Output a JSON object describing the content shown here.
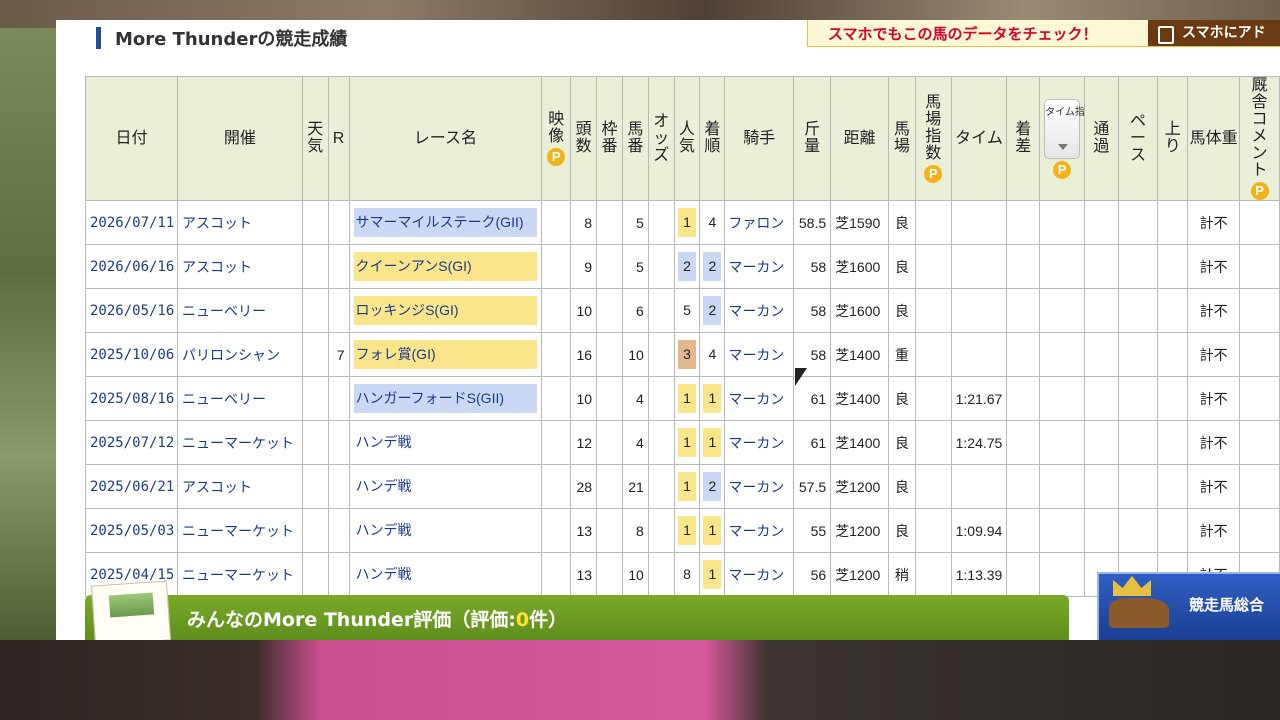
{
  "section_title": "More Thunderの競走成績",
  "promo": {
    "text": "スマホでもこの馬のデータをチェック！",
    "button": "スマホにアド"
  },
  "columns": {
    "date": "日付",
    "venue": "開催",
    "weather": "天気",
    "race_no": "R",
    "race_name": "レース名",
    "video": "映像",
    "runners": "頭数",
    "gate": "枠番",
    "horse_no": "馬番",
    "odds": "オッズ",
    "popularity": "人気",
    "finish": "着順",
    "jockey": "騎手",
    "weight": "斤量",
    "distance": "距離",
    "track": "馬場",
    "track_index": "馬場指数",
    "time": "タイム",
    "margin": "着差",
    "time_index": "タイム指数",
    "passing": "通過",
    "pace": "ペース",
    "last3f": "上り",
    "body_weight": "馬体重",
    "stable_comment": "厩舎コメント",
    "p_badge": "P"
  },
  "rows": [
    {
      "date": "2026/07/11",
      "venue": "アスコット",
      "race_no": "",
      "race": "サマーマイルステーク(GII)",
      "grade": "g2",
      "runners": "8",
      "gate": "",
      "horse_no": "5",
      "popularity": "1",
      "pop_class": "p1",
      "finish": "4",
      "fin_class": "",
      "jockey": "ファロン",
      "weight": "58.5",
      "distance": "芝1590",
      "track": "良",
      "time": "",
      "body_weight": "計不"
    },
    {
      "date": "2026/06/16",
      "venue": "アスコット",
      "race_no": "",
      "race": "クイーンアンS(GI)",
      "grade": "g1",
      "runners": "9",
      "gate": "",
      "horse_no": "5",
      "popularity": "2",
      "pop_class": "p2",
      "finish": "2",
      "fin_class": "p2",
      "jockey": "マーカン",
      "weight": "58",
      "distance": "芝1600",
      "track": "良",
      "time": "",
      "body_weight": "計不"
    },
    {
      "date": "2026/05/16",
      "venue": "ニューベリー",
      "race_no": "",
      "race": "ロッキンジS(GI)",
      "grade": "g1",
      "runners": "10",
      "gate": "",
      "horse_no": "6",
      "popularity": "5",
      "pop_class": "",
      "finish": "2",
      "fin_class": "p2",
      "jockey": "マーカン",
      "weight": "58",
      "distance": "芝1600",
      "track": "良",
      "time": "",
      "body_weight": "計不"
    },
    {
      "date": "2025/10/06",
      "venue": "パリロンシャン",
      "race_no": "7",
      "race": "フォレ賞(GI)",
      "grade": "g1",
      "runners": "16",
      "gate": "",
      "horse_no": "10",
      "popularity": "3",
      "pop_class": "p3",
      "finish": "4",
      "fin_class": "",
      "jockey": "マーカン",
      "weight": "58",
      "distance": "芝1400",
      "track": "重",
      "time": "",
      "body_weight": "計不"
    },
    {
      "date": "2025/08/16",
      "venue": "ニューベリー",
      "race_no": "",
      "race": "ハンガーフォードS(GII)",
      "grade": "g2",
      "runners": "10",
      "gate": "",
      "horse_no": "4",
      "popularity": "1",
      "pop_class": "p1",
      "finish": "1",
      "fin_class": "p1",
      "jockey": "マーカン",
      "weight": "61",
      "distance": "芝1400",
      "track": "良",
      "time": "1:21.67",
      "body_weight": "計不"
    },
    {
      "date": "2025/07/12",
      "venue": "ニューマーケット",
      "race_no": "",
      "race": "ハンデ戦",
      "grade": "",
      "runners": "12",
      "gate": "",
      "horse_no": "4",
      "popularity": "1",
      "pop_class": "p1",
      "finish": "1",
      "fin_class": "p1",
      "jockey": "マーカン",
      "weight": "61",
      "distance": "芝1400",
      "track": "良",
      "time": "1:24.75",
      "body_weight": "計不"
    },
    {
      "date": "2025/06/21",
      "venue": "アスコット",
      "race_no": "",
      "race": "ハンデ戦",
      "grade": "",
      "runners": "28",
      "gate": "",
      "horse_no": "21",
      "popularity": "1",
      "pop_class": "p1",
      "finish": "2",
      "fin_class": "p2",
      "jockey": "マーカン",
      "weight": "57.5",
      "distance": "芝1200",
      "track": "良",
      "time": "",
      "body_weight": "計不"
    },
    {
      "date": "2025/05/03",
      "venue": "ニューマーケット",
      "race_no": "",
      "race": "ハンデ戦",
      "grade": "",
      "runners": "13",
      "gate": "",
      "horse_no": "8",
      "popularity": "1",
      "pop_class": "p1",
      "finish": "1",
      "fin_class": "p1",
      "jockey": "マーカン",
      "weight": "55",
      "distance": "芝1200",
      "track": "良",
      "time": "1:09.94",
      "body_weight": "計不"
    },
    {
      "date": "2025/04/15",
      "venue": "ニューマーケット",
      "race_no": "",
      "race": "ハンデ戦",
      "grade": "",
      "runners": "13",
      "gate": "",
      "horse_no": "10",
      "popularity": "8",
      "pop_class": "",
      "finish": "1",
      "fin_class": "p1",
      "jockey": "マーカン",
      "weight": "56",
      "distance": "芝1200",
      "track": "稍",
      "time": "1:13.39",
      "body_weight": "計不"
    }
  ],
  "review": {
    "prefix": "みんなのMore Thunder評価（評価:",
    "count": "0",
    "suffix": "件）"
  },
  "overall_banner": {
    "text": "競走馬総合"
  },
  "colors": {
    "header_bg": "#eaefd8",
    "grade1": "#fbe58a",
    "grade2": "#c9d8f5",
    "pop3": "#e4b88f",
    "link": "#1a3a8c",
    "review_bar": "#6a9a22"
  }
}
